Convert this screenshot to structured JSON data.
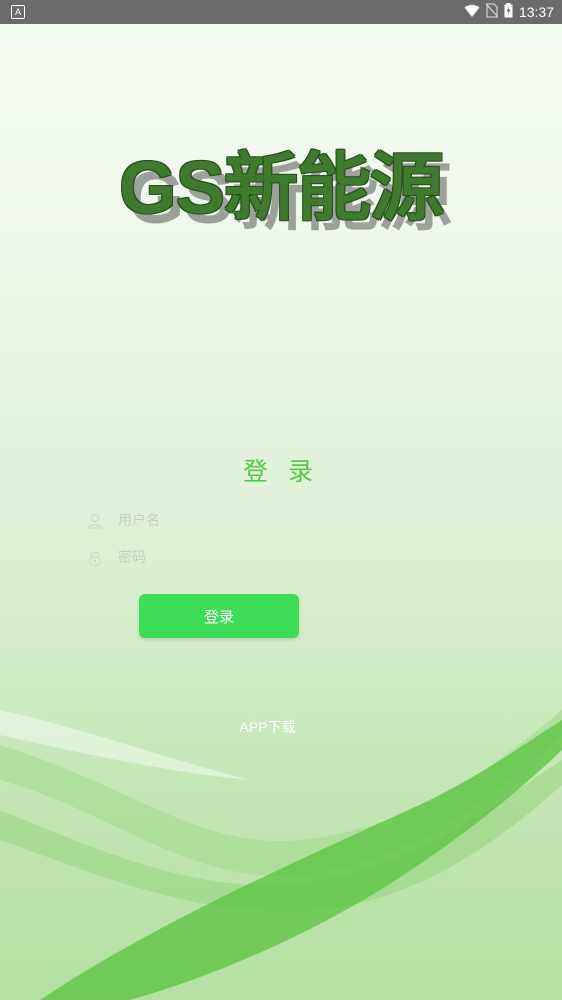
{
  "status_bar": {
    "app_badge": "A",
    "time": "13:37"
  },
  "logo": {
    "text": "GS新能源"
  },
  "login": {
    "title": "登 录",
    "username_placeholder": "用户名",
    "password_placeholder": "密码",
    "button_label": "登录"
  },
  "footer": {
    "download_label": "APP下载"
  },
  "colors": {
    "accent_green": "#3ddc56",
    "title_green": "#55c84a",
    "logo_green": "#3f7a2e"
  },
  "icons": [
    "user-icon",
    "lock-icon",
    "wifi-icon",
    "no-sim-icon",
    "battery-charging-icon"
  ]
}
